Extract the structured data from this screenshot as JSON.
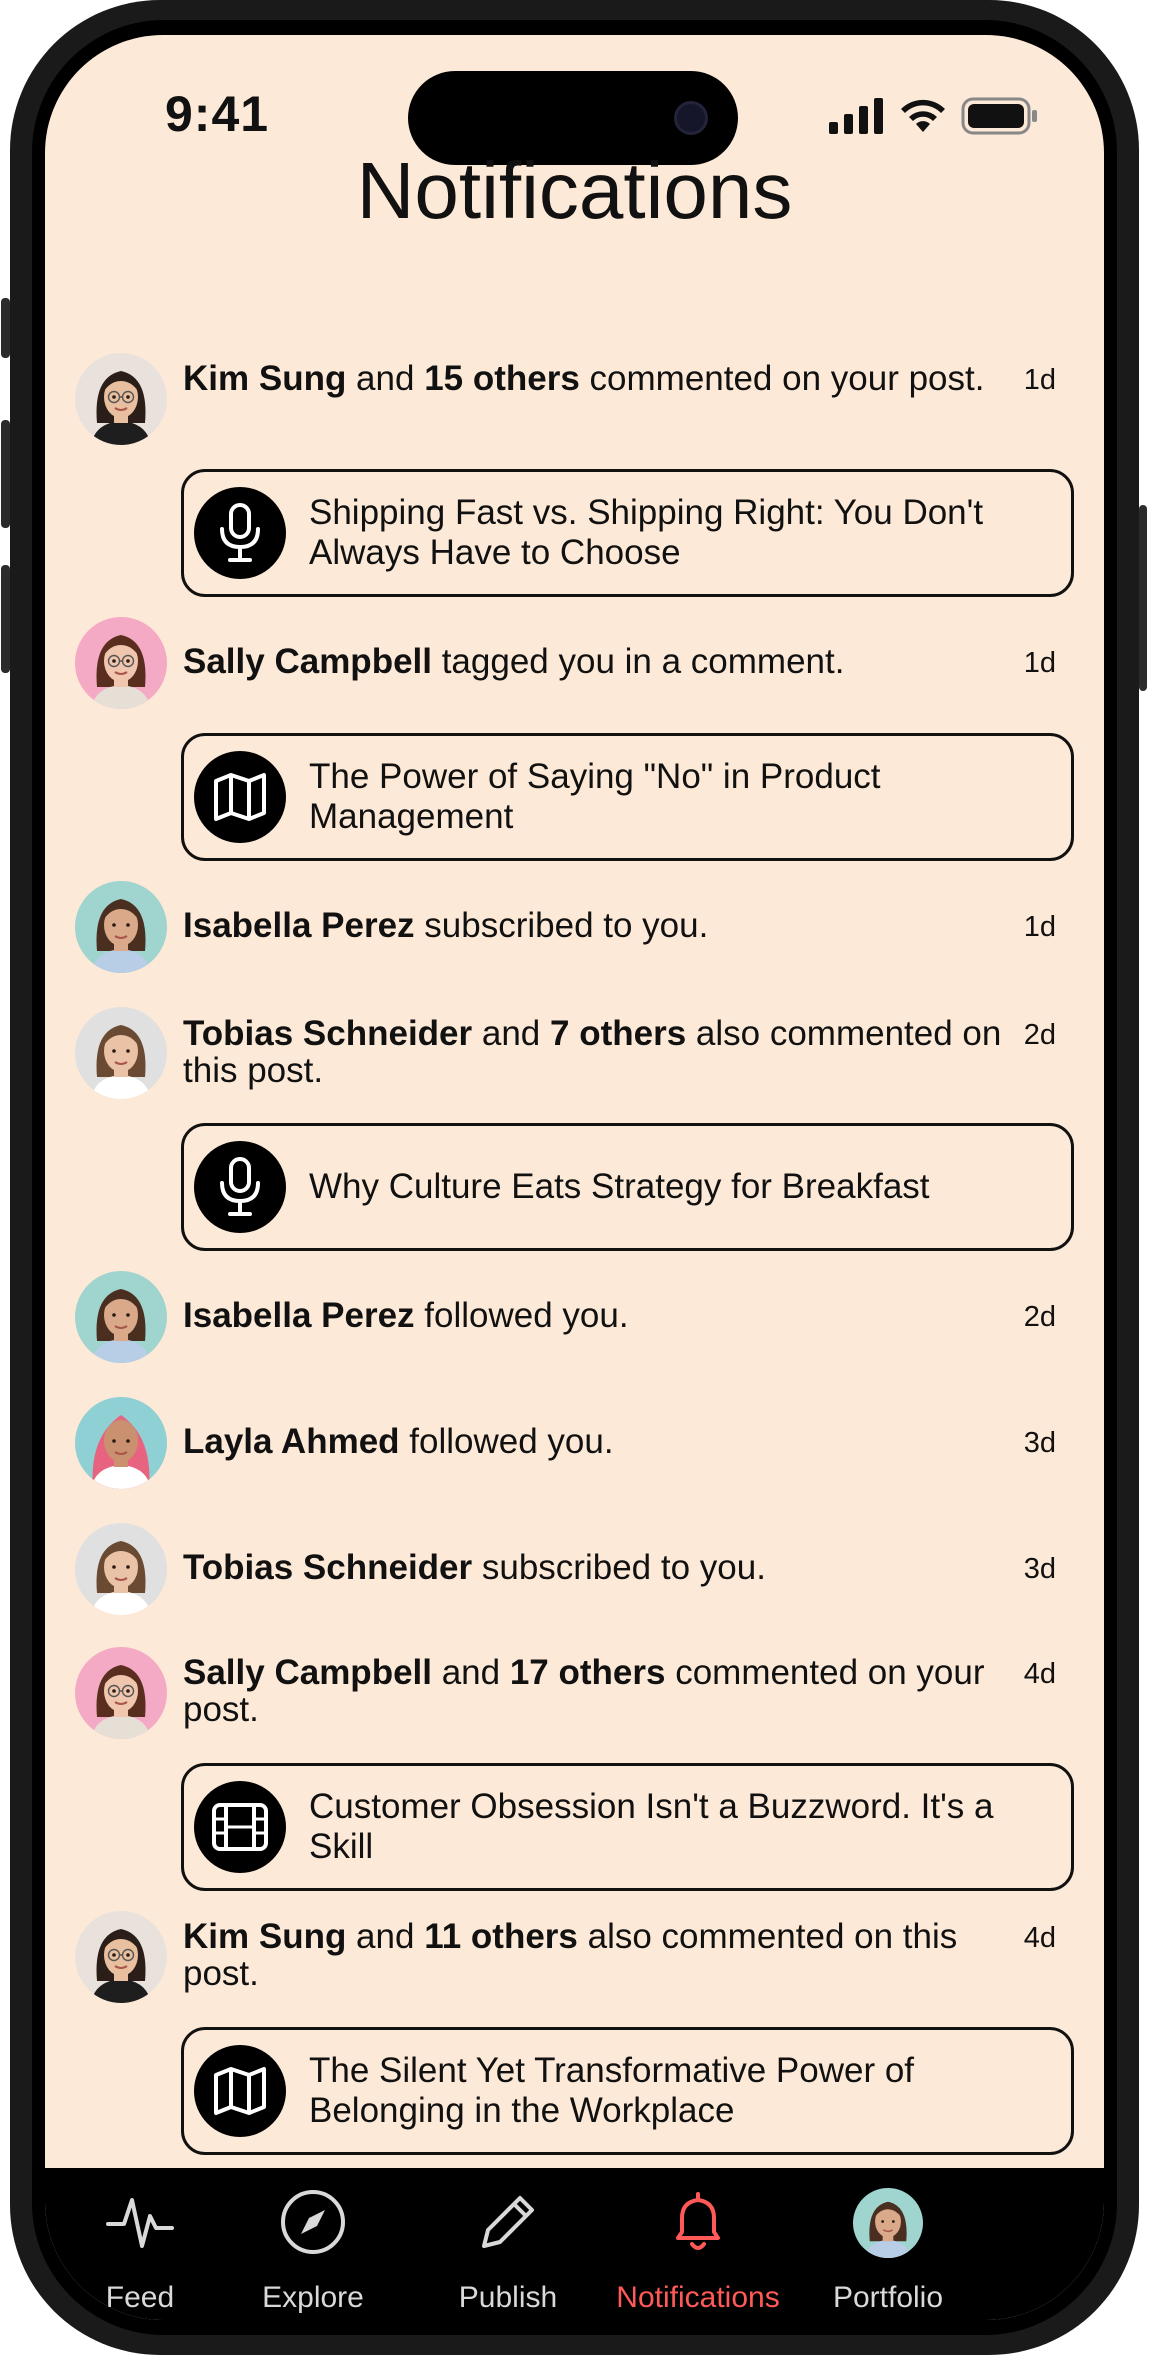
{
  "status_bar": {
    "time": "9:41"
  },
  "header": {
    "title": "Notifications"
  },
  "notifications": [
    {
      "parts": [
        {
          "t": "Kim Sung",
          "b": true
        },
        {
          "t": " and ",
          "b": false
        },
        {
          "t": "15 others",
          "b": true
        },
        {
          "t": " commented on your post.",
          "b": false
        }
      ],
      "time": "1d",
      "avatar": "kim",
      "post": {
        "icon": "microphone-icon",
        "title": "Shipping Fast vs. Shipping Right: You Don't Always Have to Choose"
      }
    },
    {
      "parts": [
        {
          "t": "Sally Campbell",
          "b": true
        },
        {
          "t": " tagged you in a comment.",
          "b": false
        }
      ],
      "time": "1d",
      "avatar": "sally",
      "post": {
        "icon": "map-icon",
        "title": "The Power of Saying \"No\" in Product Management"
      }
    },
    {
      "parts": [
        {
          "t": "Isabella Perez",
          "b": true
        },
        {
          "t": " subscribed to you.",
          "b": false
        }
      ],
      "time": "1d",
      "avatar": "isabella"
    },
    {
      "parts": [
        {
          "t": "Tobias Schneider",
          "b": true
        },
        {
          "t": " and ",
          "b": false
        },
        {
          "t": "7 others",
          "b": true
        },
        {
          "t": " also commented on this post.",
          "b": false
        }
      ],
      "time": "2d",
      "avatar": "tobias",
      "post": {
        "icon": "microphone-icon",
        "title": "Why Culture Eats Strategy for Breakfast"
      }
    },
    {
      "parts": [
        {
          "t": "Isabella Perez",
          "b": true
        },
        {
          "t": " followed you.",
          "b": false
        }
      ],
      "time": "2d",
      "avatar": "isabella"
    },
    {
      "parts": [
        {
          "t": "Layla Ahmed",
          "b": true
        },
        {
          "t": " followed you.",
          "b": false
        }
      ],
      "time": "3d",
      "avatar": "layla"
    },
    {
      "parts": [
        {
          "t": "Tobias Schneider",
          "b": true
        },
        {
          "t": " subscribed to you.",
          "b": false
        }
      ],
      "time": "3d",
      "avatar": "tobias"
    },
    {
      "parts": [
        {
          "t": "Sally Campbell",
          "b": true
        },
        {
          "t": " and ",
          "b": false
        },
        {
          "t": "17 others",
          "b": true
        },
        {
          "t": " commented on your post.",
          "b": false
        }
      ],
      "time": "4d",
      "avatar": "sally",
      "post": {
        "icon": "film-icon",
        "title": "Customer Obsession Isn't a Buzzword. It's a Skill"
      }
    },
    {
      "parts": [
        {
          "t": "Kim Sung",
          "b": true
        },
        {
          "t": " and ",
          "b": false
        },
        {
          "t": "11 others",
          "b": true
        },
        {
          "t": " also commented on this post.",
          "b": false
        }
      ],
      "time": "4d",
      "avatar": "kim",
      "post": {
        "icon": "map-icon",
        "title": "The Silent Yet Transformative Power of Belonging in the Workplace"
      }
    }
  ],
  "tabs": [
    {
      "label": "Feed",
      "icon": "pulse-icon",
      "active": false
    },
    {
      "label": "Explore",
      "icon": "compass-icon",
      "active": false
    },
    {
      "label": "Publish",
      "icon": "pencil-icon",
      "active": false
    },
    {
      "label": "Notifications",
      "icon": "bell-icon",
      "active": true
    },
    {
      "label": "Portfolio",
      "icon": "avatar",
      "active": false
    }
  ],
  "colors": {
    "background": "#fde9d7",
    "accent": "#ff5a58",
    "tabbar": "#000000"
  }
}
